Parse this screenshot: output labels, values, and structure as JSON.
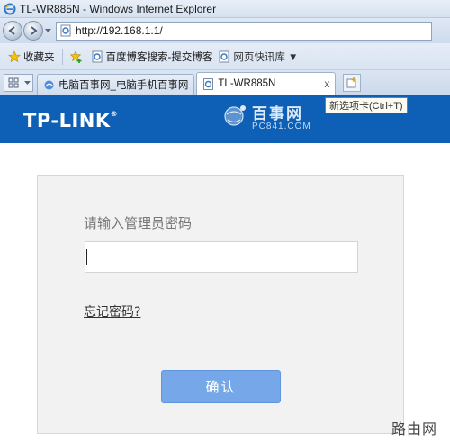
{
  "window": {
    "title": "TL-WR885N - Windows Internet Explorer"
  },
  "navigation": {
    "url": "http://192.168.1.1/"
  },
  "favorites_bar": {
    "favorites_label": "收藏夹",
    "links": [
      "百度博客搜索-提交博客",
      "网页快讯库 ▼"
    ]
  },
  "tabs": {
    "items": [
      {
        "label": "电脑百事网_电脑手机百事网"
      },
      {
        "label": "TL-WR885N"
      }
    ],
    "close_glyph": "x",
    "new_tab_tooltip": "新选项卡(Ctrl+T)"
  },
  "header": {
    "brand": "TP-LINK",
    "brand_mark": "®",
    "watermark_title": "百事网",
    "watermark_sub": "PC841.COM"
  },
  "login": {
    "prompt": "请输入管理员密码",
    "password_value": "",
    "forgot_link": "忘记密码?",
    "confirm_label": "确认"
  },
  "corner_watermark": "路由网",
  "colors": {
    "header_bg": "#0e5fb6",
    "button_bg": "#76a7e8",
    "panel_bg": "#f2f2f2"
  }
}
